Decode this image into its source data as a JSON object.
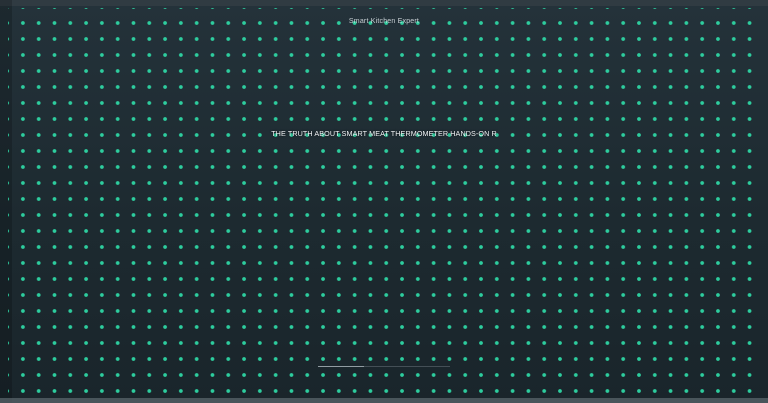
{
  "channel": {
    "name": "Smart Kitchen Expert"
  },
  "video": {
    "title": "THE TRUTH ABOUT SMART MEAT THERMOMETER HANDS-ON R"
  },
  "playback": {
    "progress_fraction": 0.35
  },
  "colors": {
    "background": "#1f2a2e",
    "dot_accent": "#2ed6a4",
    "text": "#f2f5f7"
  }
}
